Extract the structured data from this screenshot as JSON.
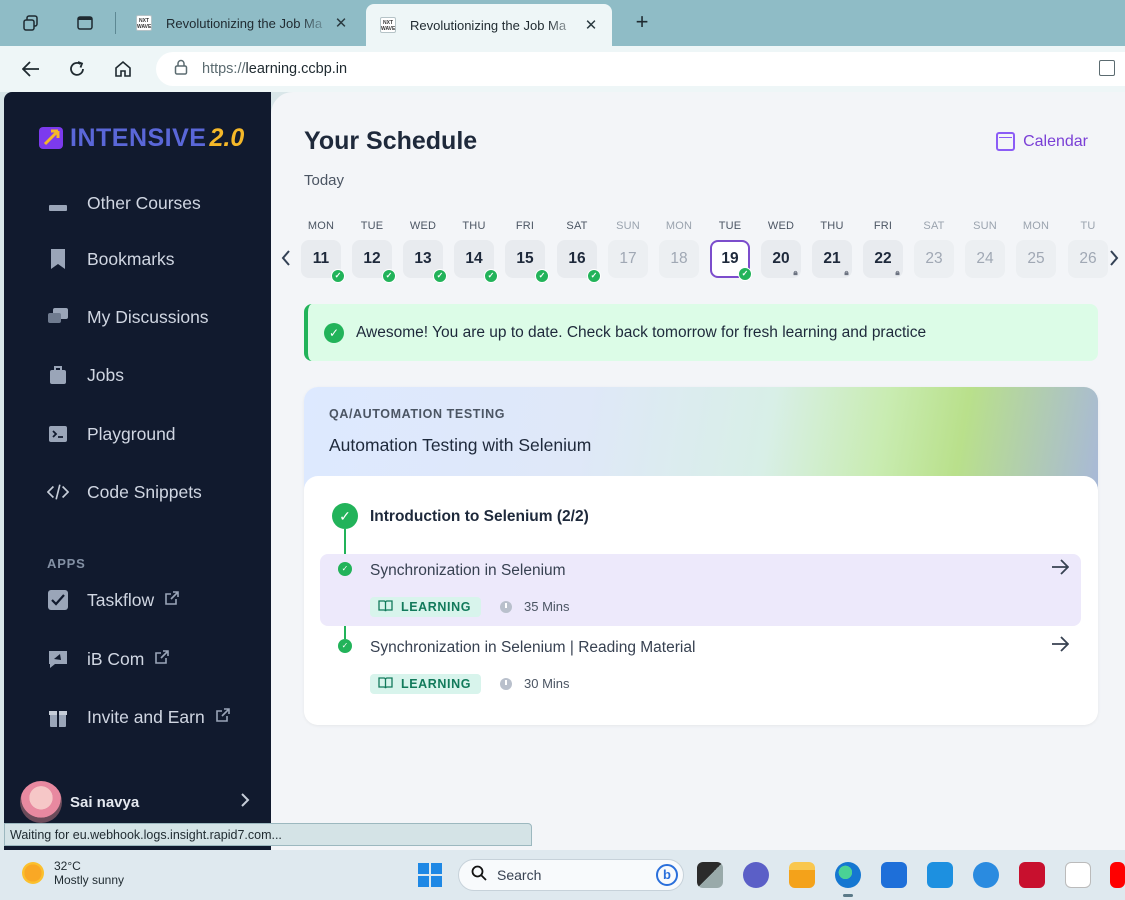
{
  "browser": {
    "tabs": [
      {
        "title": "Revolutionizing the Job Ma",
        "favicon": "NXT WAVE"
      },
      {
        "title": "Revolutionizing the Job Ma",
        "favicon": "NXT WAVE"
      }
    ],
    "url_protocol": "https://",
    "url_host": "learning.ccbp.in"
  },
  "sidebar": {
    "logo_text": "INTENSIVE",
    "logo_version": "2.0",
    "items": [
      {
        "label": "Other Courses",
        "icon": "stack-icon"
      },
      {
        "label": "Bookmarks",
        "icon": "bookmark-icon"
      },
      {
        "label": "My Discussions",
        "icon": "chat-icon"
      },
      {
        "label": "Jobs",
        "icon": "briefcase-icon"
      },
      {
        "label": "Playground",
        "icon": "terminal-icon"
      },
      {
        "label": "Code Snippets",
        "icon": "code-icon"
      }
    ],
    "apps_label": "APPS",
    "apps": [
      {
        "label": "Taskflow",
        "icon": "checkbox-icon"
      },
      {
        "label": "iB Com",
        "icon": "megaphone-icon"
      },
      {
        "label": "Invite and Earn",
        "icon": "gift-icon"
      }
    ],
    "profile_name": "Sai navya"
  },
  "main": {
    "title": "Your Schedule",
    "calendar_label": "Calendar",
    "today_label": "Today",
    "week": [
      {
        "day": "MON",
        "date": "11",
        "state": "done"
      },
      {
        "day": "TUE",
        "date": "12",
        "state": "done"
      },
      {
        "day": "WED",
        "date": "13",
        "state": "done"
      },
      {
        "day": "THU",
        "date": "14",
        "state": "done"
      },
      {
        "day": "FRI",
        "date": "15",
        "state": "done"
      },
      {
        "day": "SAT",
        "date": "16",
        "state": "done"
      },
      {
        "day": "SUN",
        "date": "17",
        "state": "off"
      },
      {
        "day": "MON",
        "date": "18",
        "state": "off"
      },
      {
        "day": "TUE",
        "date": "19",
        "state": "selected"
      },
      {
        "day": "WED",
        "date": "20",
        "state": "locked"
      },
      {
        "day": "THU",
        "date": "21",
        "state": "locked"
      },
      {
        "day": "FRI",
        "date": "22",
        "state": "locked"
      },
      {
        "day": "SAT",
        "date": "23",
        "state": "off"
      },
      {
        "day": "SUN",
        "date": "24",
        "state": "off"
      },
      {
        "day": "MON",
        "date": "25",
        "state": "off"
      },
      {
        "day": "TU",
        "date": "26",
        "state": "off"
      }
    ],
    "alert_text": "Awesome! You are up to date. Check back tomorrow for fresh learning and practice",
    "course": {
      "category": "QA/AUTOMATION TESTING",
      "name": "Automation Testing with Selenium",
      "module_title": "Introduction to Selenium (2/2)",
      "lessons": [
        {
          "title": "Synchronization in Selenium",
          "tag": "LEARNING",
          "duration": "35 Mins"
        },
        {
          "title": "Synchronization in Selenium | Reading Material",
          "tag": "LEARNING",
          "duration": "30 Mins"
        }
      ]
    }
  },
  "status_text": "Waiting for eu.webhook.logs.insight.rapid7.com...",
  "taskbar": {
    "temperature": "32°C",
    "weather": "Mostly sunny",
    "search_label": "Search"
  },
  "colors": {
    "sidebar_bg": "#111a2e",
    "accent_purple": "#7c4dcc",
    "success_green": "#22b35a",
    "logo_blue": "#5a67d8",
    "logo_gold": "#f5b829"
  }
}
